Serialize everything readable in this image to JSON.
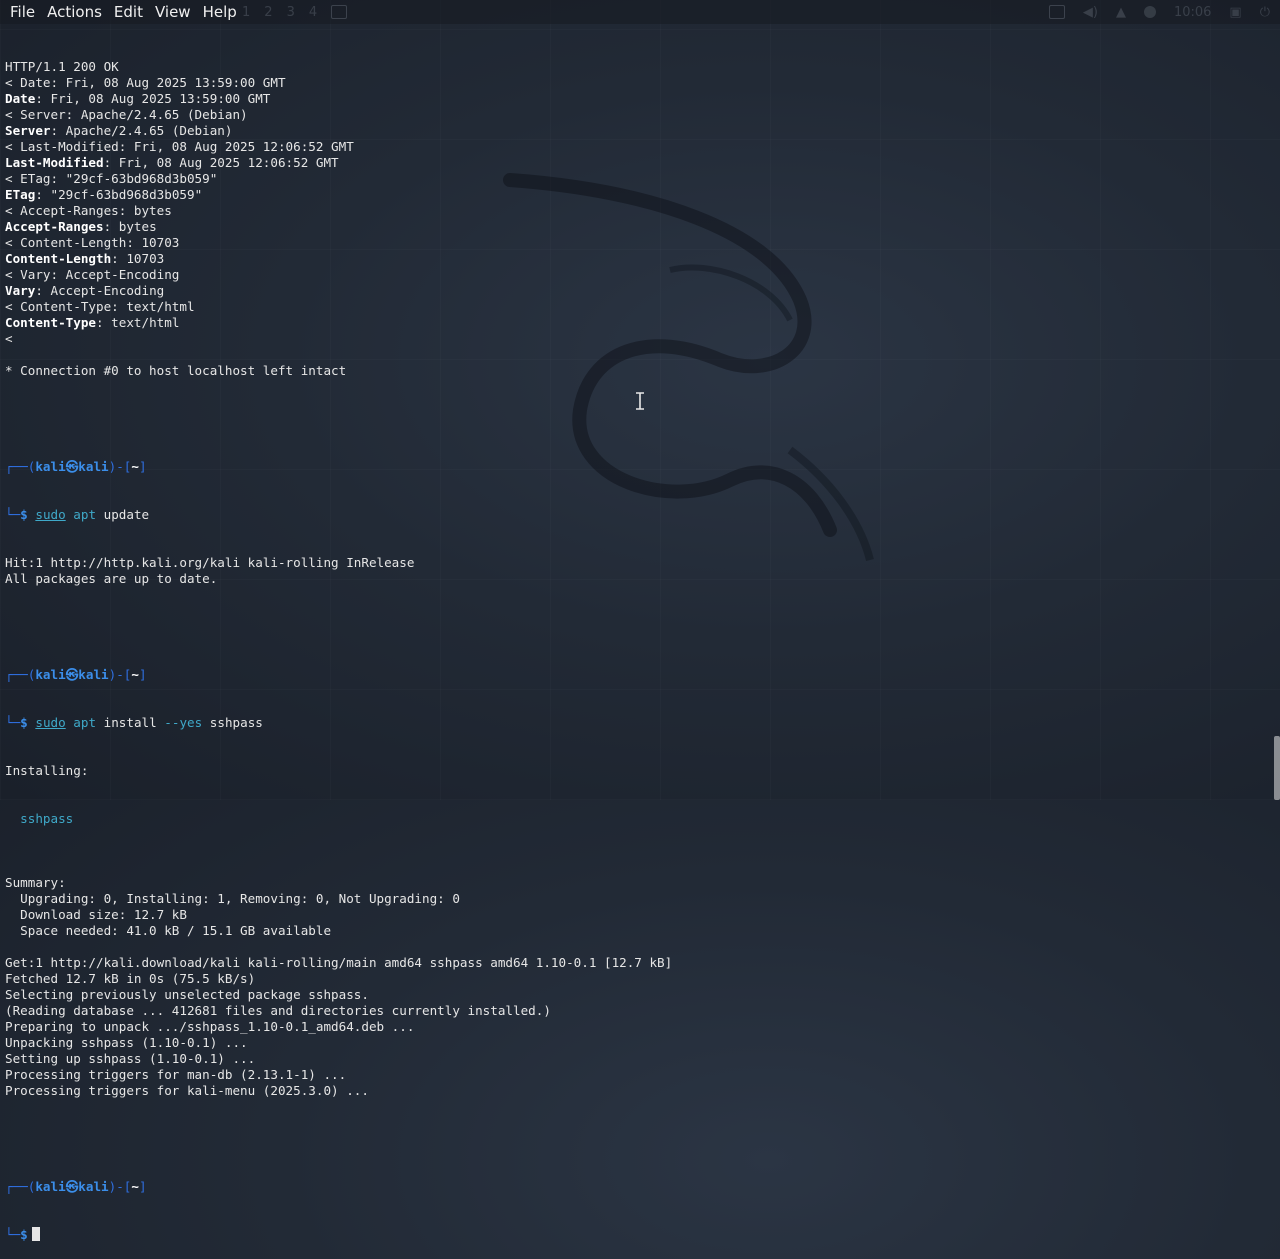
{
  "menu": [
    "File",
    "Actions",
    "Edit",
    "View",
    "Help"
  ],
  "workspaces": [
    "1",
    "2",
    "3",
    "4"
  ],
  "clock": "10:06",
  "icons": {
    "terminal": "terminal-icon",
    "volume": "volume-icon",
    "notifications": "bell-icon",
    "lock": "lock-icon",
    "power": "power-icon"
  },
  "colors": {
    "prompt": "#3b8eea",
    "command": "#3fa9c9"
  },
  "header_lines": [
    {
      "t": "plain",
      "text": "HTTP/1.1 200 OK"
    },
    {
      "t": "plain",
      "text": "< Date: Fri, 08 Aug 2025 13:59:00 GMT"
    },
    {
      "t": "kv",
      "key": "Date",
      "val": ": Fri, 08 Aug 2025 13:59:00 GMT"
    },
    {
      "t": "plain",
      "text": "< Server: Apache/2.4.65 (Debian)"
    },
    {
      "t": "kv",
      "key": "Server",
      "val": ": Apache/2.4.65 (Debian)"
    },
    {
      "t": "plain",
      "text": "< Last-Modified: Fri, 08 Aug 2025 12:06:52 GMT"
    },
    {
      "t": "kv",
      "key": "Last-Modified",
      "val": ": Fri, 08 Aug 2025 12:06:52 GMT"
    },
    {
      "t": "plain",
      "text": "< ETag: \"29cf-63bd968d3b059\""
    },
    {
      "t": "kv",
      "key": "ETag",
      "val": ": \"29cf-63bd968d3b059\""
    },
    {
      "t": "plain",
      "text": "< Accept-Ranges: bytes"
    },
    {
      "t": "kv",
      "key": "Accept-Ranges",
      "val": ": bytes"
    },
    {
      "t": "plain",
      "text": "< Content-Length: 10703"
    },
    {
      "t": "kv",
      "key": "Content-Length",
      "val": ": 10703"
    },
    {
      "t": "plain",
      "text": "< Vary: Accept-Encoding"
    },
    {
      "t": "kv",
      "key": "Vary",
      "val": ": Accept-Encoding"
    },
    {
      "t": "plain",
      "text": "< Content-Type: text/html"
    },
    {
      "t": "kv",
      "key": "Content-Type",
      "val": ": text/html"
    },
    {
      "t": "plain",
      "text": "<"
    },
    {
      "t": "plain",
      "text": ""
    },
    {
      "t": "plain",
      "text": "* Connection #0 to host localhost left intact"
    },
    {
      "t": "plain",
      "text": ""
    }
  ],
  "prompt": {
    "open": "┌──(",
    "user": "kali",
    "sep": "㉿",
    "host": "kali",
    "mid": ")-[",
    "dir": "~",
    "close": "]",
    "second": "└─",
    "dollar": "$"
  },
  "cmd1": {
    "sudo": "sudo",
    "apt": "apt",
    "rest": " update"
  },
  "cmd1_output": [
    "Hit:1 http://http.kali.org/kali kali-rolling InRelease",
    "All packages are up to date.",
    ""
  ],
  "cmd2": {
    "sudo": "sudo",
    "apt": "apt",
    "mid": " install ",
    "flag": "--yes",
    "rest": " sshpass"
  },
  "cmd2_installing": "Installing:",
  "cmd2_pkg": "  sshpass",
  "cmd2_output": [
    "",
    "Summary:",
    "  Upgrading: 0, Installing: 1, Removing: 0, Not Upgrading: 0",
    "  Download size: 12.7 kB",
    "  Space needed: 41.0 kB / 15.1 GB available",
    "",
    "Get:1 http://kali.download/kali kali-rolling/main amd64 sshpass amd64 1.10-0.1 [12.7 kB]",
    "Fetched 12.7 kB in 0s (75.5 kB/s)",
    "Selecting previously unselected package sshpass.",
    "(Reading database ... 412681 files and directories currently installed.)",
    "Preparing to unpack .../sshpass_1.10-0.1_amd64.deb ...",
    "Unpacking sshpass (1.10-0.1) ...",
    "Setting up sshpass (1.10-0.1) ...",
    "Processing triggers for man-db (2.13.1-1) ...",
    "Processing triggers for kali-menu (2025.3.0) ...",
    ""
  ]
}
